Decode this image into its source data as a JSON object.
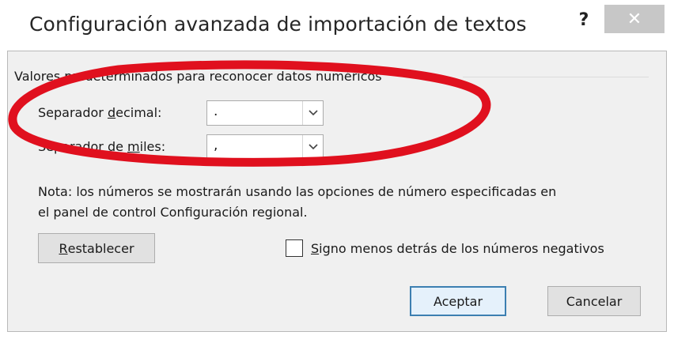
{
  "dialog": {
    "title": "Configuración avanzada de importación de textos",
    "help_label": "?",
    "close_label": "✕"
  },
  "group": {
    "label": "Valores predeterminados para reconocer datos numéricos"
  },
  "decimal": {
    "label_pre": "Separador ",
    "label_accel": "d",
    "label_post": "ecimal:",
    "value": "."
  },
  "thousands": {
    "label_pre": "Separador de ",
    "label_accel": "m",
    "label_post": "iles:",
    "value": ","
  },
  "note": {
    "line1": "Nota: los números se mostrarán usando las opciones de número especificadas en",
    "line2": "el panel de control Configuración regional."
  },
  "reset": {
    "accel": "R",
    "rest": "establecer"
  },
  "negative_sign": {
    "accel": "S",
    "rest": "igno menos detrás de los números negativos",
    "checked": false
  },
  "ok_label": "Aceptar",
  "cancel_label": "Cancelar",
  "annotation_color": "#e0101e"
}
